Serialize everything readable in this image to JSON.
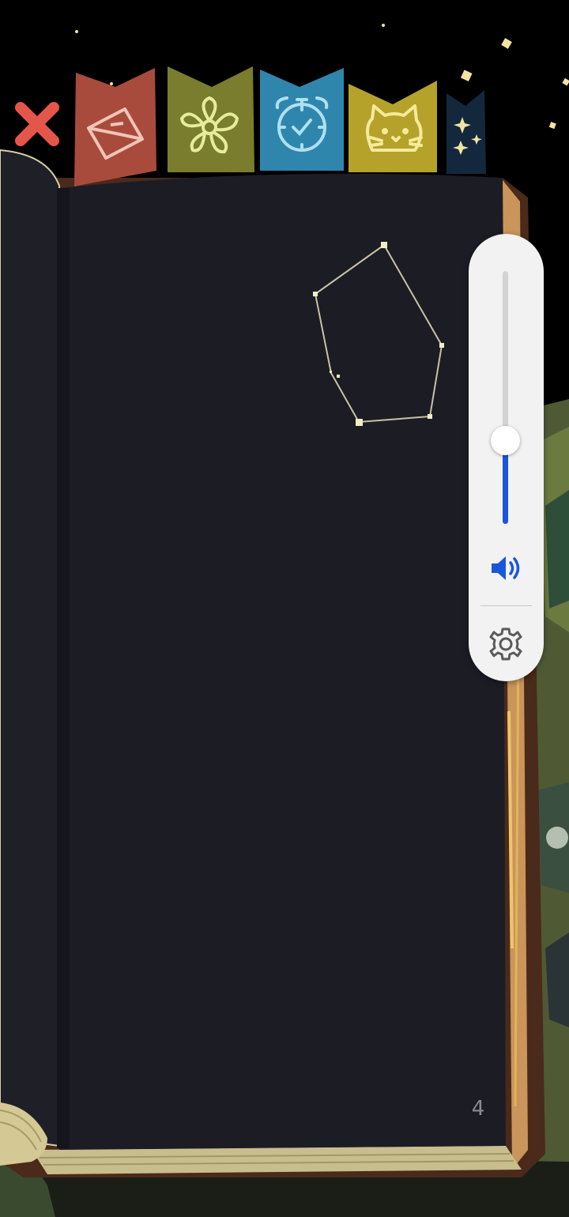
{
  "book": {
    "page_number": "4"
  },
  "tabs": [
    {
      "id": "mail",
      "icon": "envelope-icon",
      "color": "#a94b3c"
    },
    {
      "id": "flower",
      "icon": "flower-icon",
      "color": "#7a7c2e"
    },
    {
      "id": "alarm",
      "icon": "alarm-clock-icon",
      "color": "#2f86ad"
    },
    {
      "id": "cat",
      "icon": "cat-icon",
      "color": "#b5a22a"
    },
    {
      "id": "stars",
      "icon": "stars-icon",
      "color": "#13283d"
    }
  ],
  "close": {
    "icon": "close-x-icon",
    "color": "#e5564a"
  },
  "volume": {
    "level_fraction": 0.33,
    "accent_color": "#1a56db",
    "speaker_icon": "speaker-volume-icon",
    "settings_icon": "gear-icon"
  },
  "colors": {
    "page": "#1c1c25",
    "sky": "#000000",
    "constellation": "#c9c2a3"
  }
}
